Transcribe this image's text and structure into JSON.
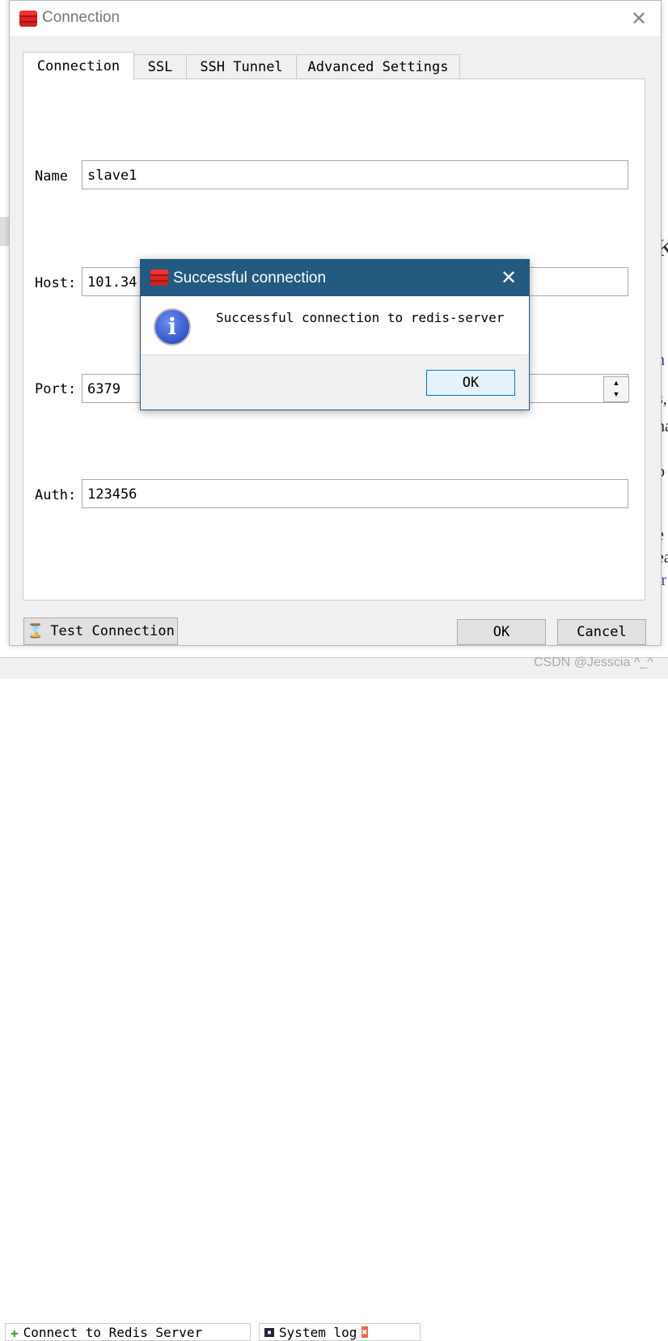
{
  "window": {
    "title": "Connection",
    "close_icon": "close-icon"
  },
  "tabs": [
    {
      "label": "Connection",
      "active": true
    },
    {
      "label": "SSL"
    },
    {
      "label": "SSH Tunnel"
    },
    {
      "label": "Advanced Settings"
    }
  ],
  "form": {
    "name": {
      "label": "Name",
      "value": "slave1"
    },
    "host": {
      "label": "Host:",
      "value": "101.34."
    },
    "port": {
      "label": "Port:",
      "value": "6379"
    },
    "auth": {
      "label": "Auth:",
      "value": "123456"
    }
  },
  "buttons": {
    "test": "Test Connection",
    "ok": "OK",
    "cancel": "Cancel"
  },
  "popup": {
    "title": "Successful connection",
    "message": "Successful connection to redis-server",
    "ok": "OK",
    "title_color": "#235a80"
  },
  "background": {
    "tab1": "Connect to Redis Server",
    "tab2": "System log",
    "fragments": [
      "K",
      "n",
      "s,",
      "na",
      "b",
      "i",
      "e",
      "ea",
      "ir"
    ]
  },
  "watermark": "CSDN @Jesscia ^_^"
}
